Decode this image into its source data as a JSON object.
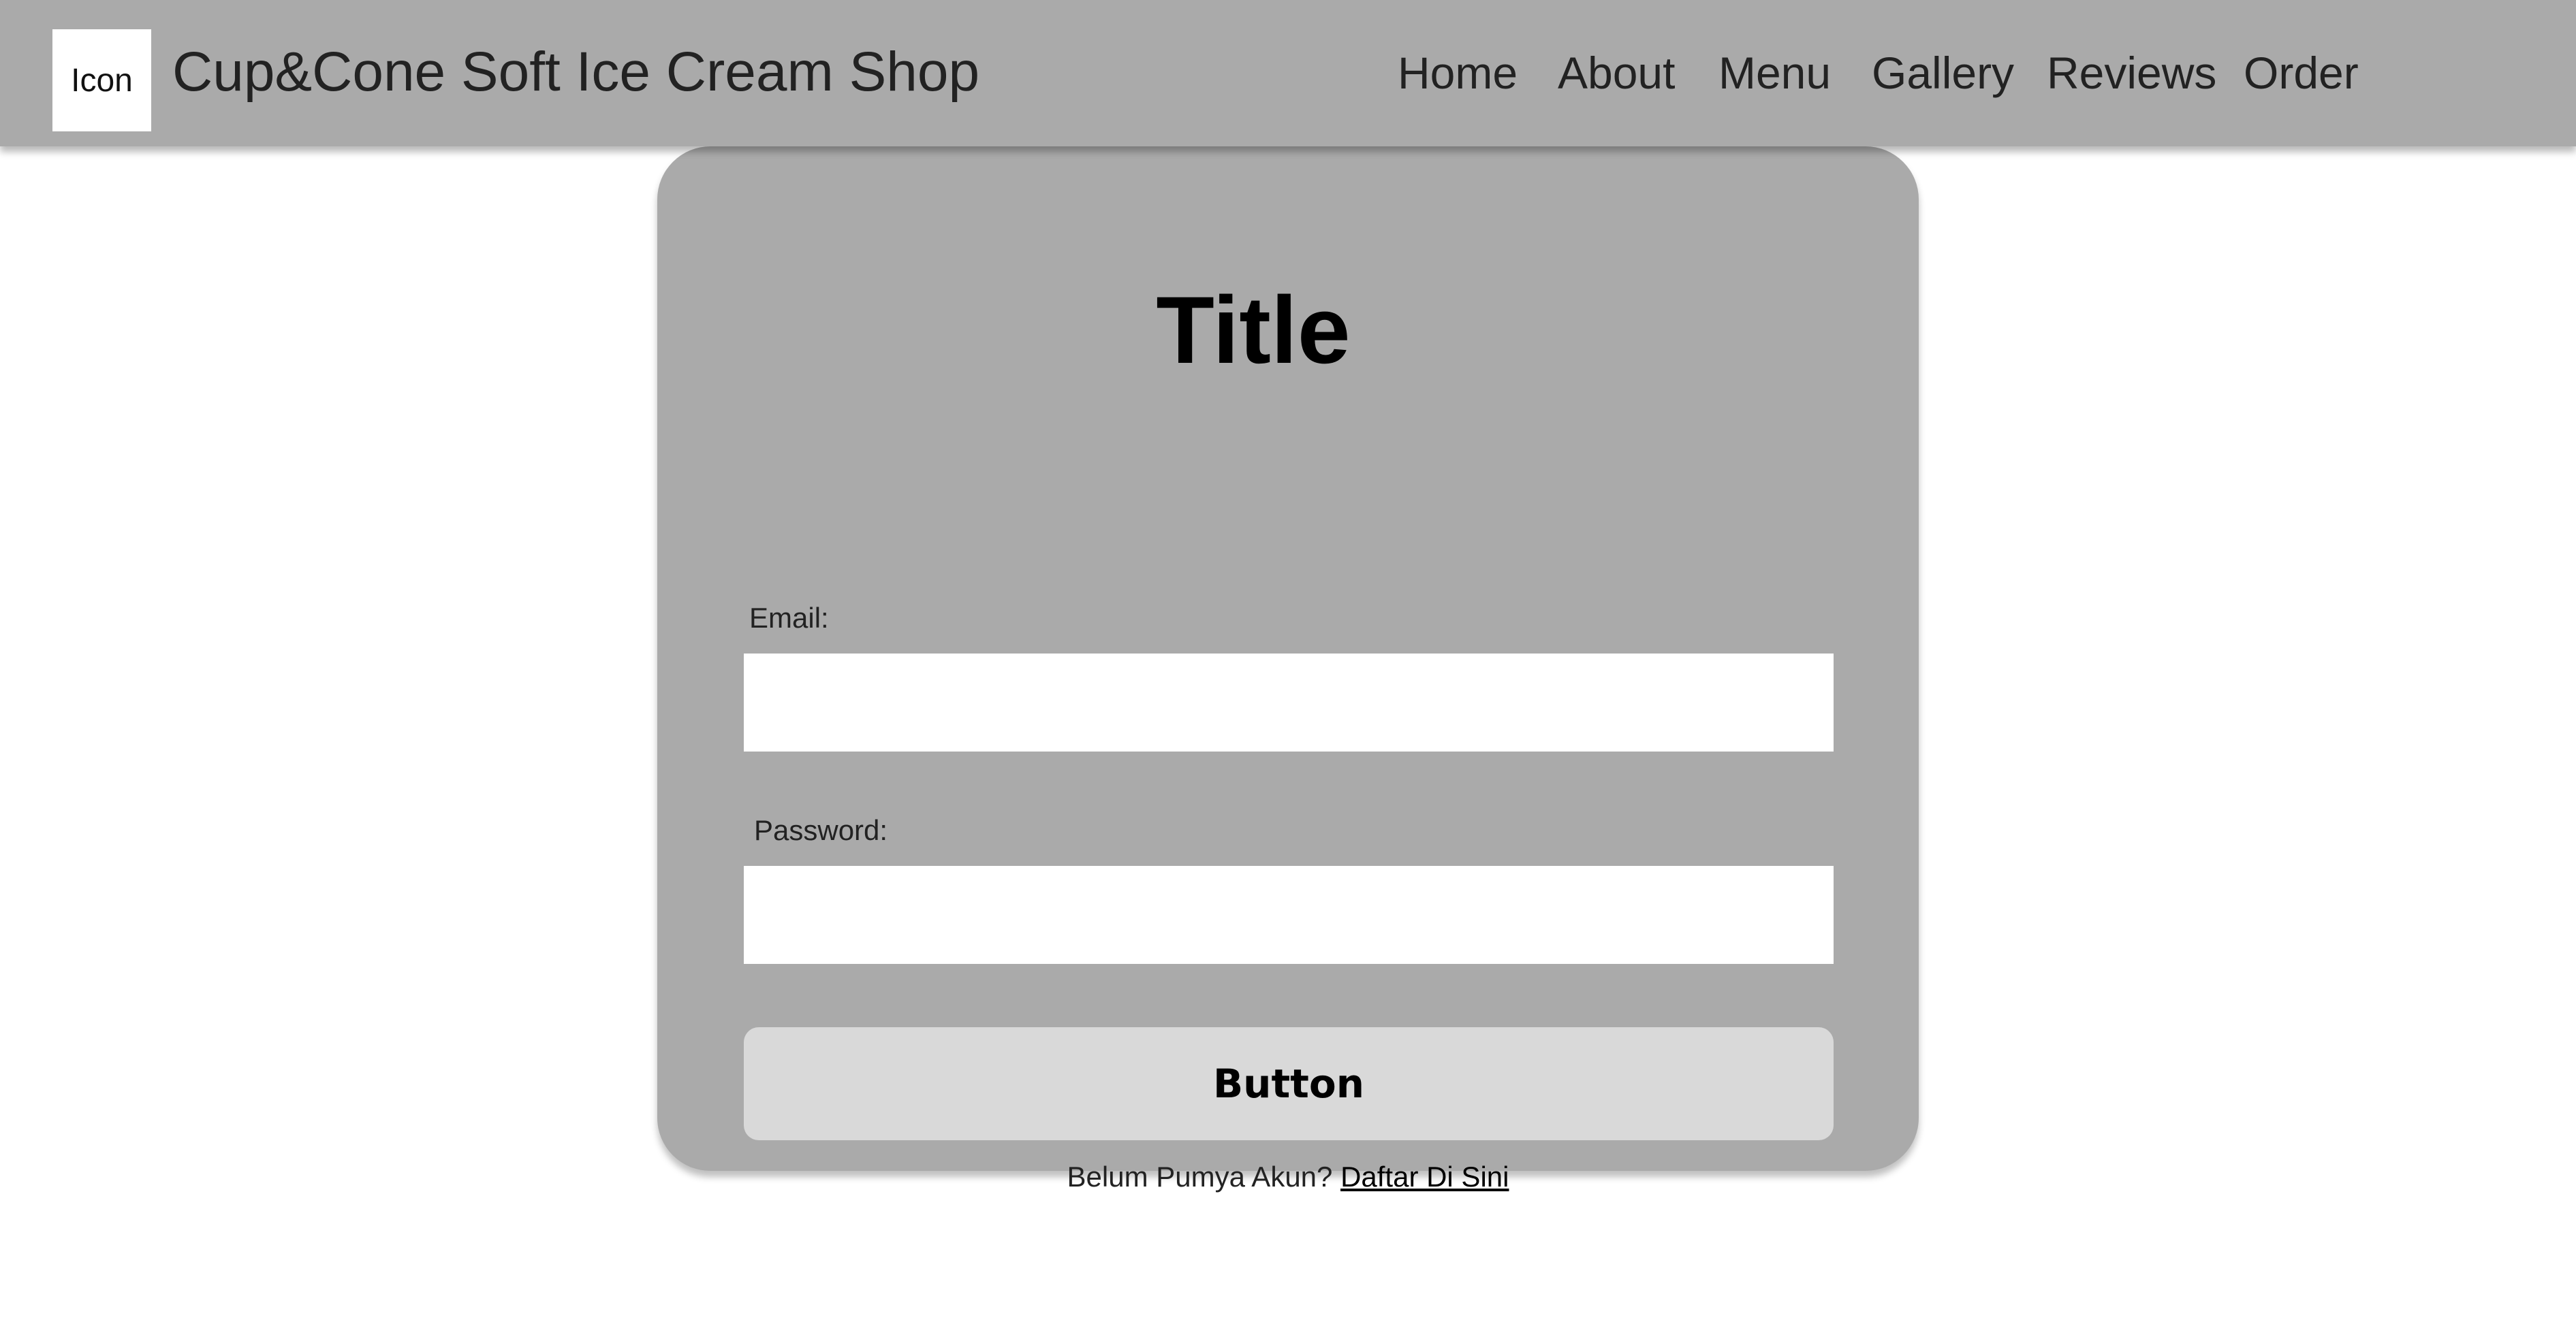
{
  "header": {
    "logo_text": "Icon",
    "brand_title": "Cup&Cone Soft Ice Cream Shop",
    "nav": [
      {
        "label": "Home"
      },
      {
        "label": "About"
      },
      {
        "label": "Menu"
      },
      {
        "label": "Gallery"
      },
      {
        "label": "Reviews"
      },
      {
        "label": "Order"
      }
    ]
  },
  "form": {
    "title": "Title",
    "email_label": "Email:",
    "email_value": "",
    "password_label": "Password:",
    "password_value": "",
    "submit_label": "Button",
    "signup_prompt": "Belum Pumya Akun?",
    "signup_link": "Daftar Di Sini"
  },
  "colors": {
    "header_bg": "#aaaaaa",
    "card_bg": "#aaaaaa",
    "button_bg": "#d9d9d9",
    "input_bg": "#ffffff",
    "page_bg": "#ffffff"
  }
}
